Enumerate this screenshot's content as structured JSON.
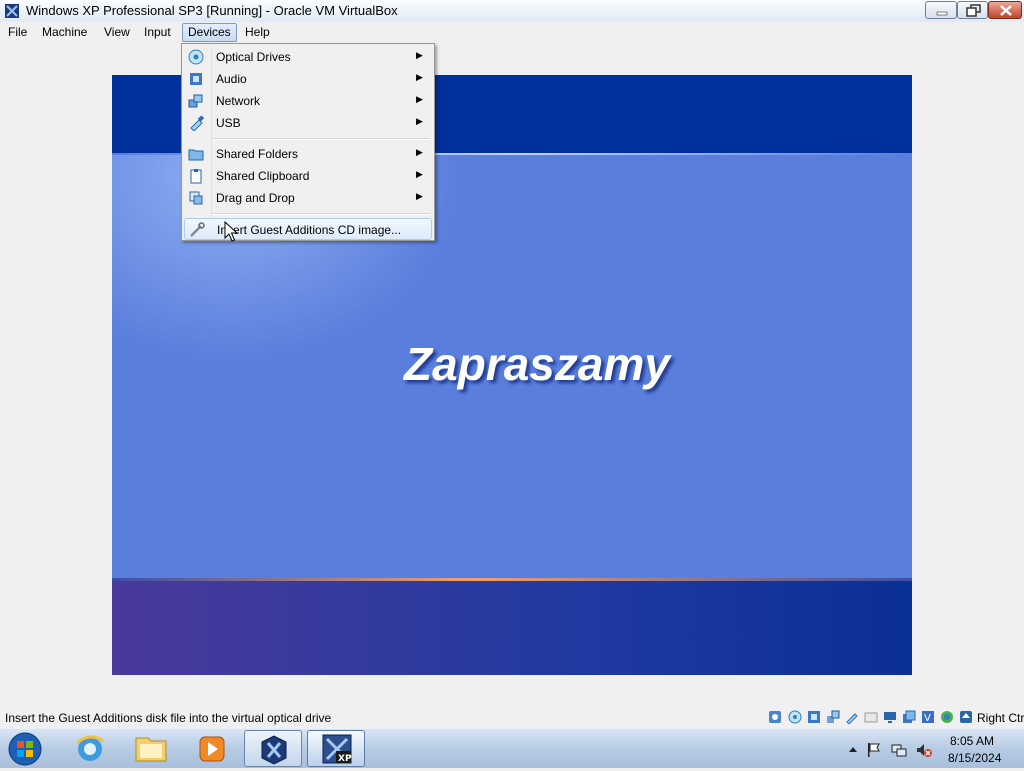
{
  "window": {
    "title": "Windows XP Professional SP3 [Running] - Oracle VM VirtualBox",
    "icon": "virtualbox-app-icon"
  },
  "menubar": {
    "items": [
      {
        "label": "File"
      },
      {
        "label": "Machine"
      },
      {
        "label": "View"
      },
      {
        "label": "Input"
      },
      {
        "label": "Devices",
        "active": true
      },
      {
        "label": "Help"
      }
    ]
  },
  "devices_menu": {
    "items": [
      {
        "label": "Optical Drives",
        "icon": "optical-disc-icon",
        "submenu": true
      },
      {
        "label": "Audio",
        "icon": "audio-icon",
        "submenu": true
      },
      {
        "label": "Network",
        "icon": "network-icon",
        "submenu": true
      },
      {
        "label": "USB",
        "icon": "usb-icon",
        "submenu": true
      },
      {
        "label": "Shared Folders",
        "icon": "shared-folder-icon",
        "submenu": true
      },
      {
        "label": "Shared Clipboard",
        "icon": "clipboard-icon",
        "submenu": true
      },
      {
        "label": "Drag and Drop",
        "icon": "drag-drop-icon",
        "submenu": true
      },
      {
        "label": "Insert Guest Additions CD image...",
        "icon": "guest-additions-icon",
        "submenu": false,
        "highlighted": true
      }
    ],
    "submenu_arrow": "▶"
  },
  "guest": {
    "welcome_text": "Zapraszamy"
  },
  "statusbar": {
    "text": "Insert the Guest Additions disk file into the virtual optical drive",
    "host_key": "Right Ctrl"
  },
  "taskbar": {
    "clock_time": "8:05 AM",
    "clock_date": "8/15/2024"
  }
}
